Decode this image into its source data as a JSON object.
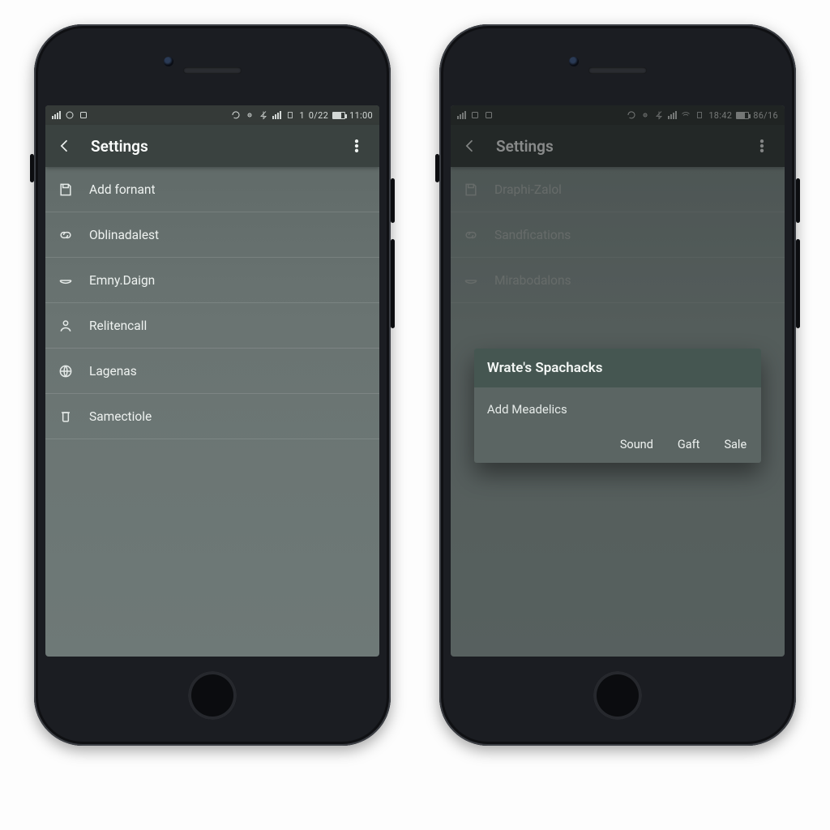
{
  "phone1": {
    "status": {
      "left_icons": [
        "signal-icon",
        "sync-icon",
        "card-icon"
      ],
      "right_icons": [
        "refresh-icon",
        "gps-icon",
        "bluetooth-icon",
        "signal-icon",
        "cell-icon"
      ],
      "right_text_1": "1",
      "right_text_2": "0/22",
      "time": "11:00"
    },
    "appbar": {
      "title": "Settings"
    },
    "items": [
      {
        "icon": "save-icon",
        "label": "Add fornant"
      },
      {
        "icon": "link-icon",
        "label": "Oblinadalest"
      },
      {
        "icon": "bowl-icon",
        "label": "Emny.Daign"
      },
      {
        "icon": "person-icon",
        "label": "Relitencall"
      },
      {
        "icon": "globe-icon",
        "label": "Lagenas"
      },
      {
        "icon": "trash-icon",
        "label": "Samectiole"
      }
    ]
  },
  "phone2": {
    "status": {
      "left_icons": [
        "signal-icon",
        "card-icon",
        "card-icon"
      ],
      "right_icons": [
        "refresh-icon",
        "gps-icon",
        "bluetooth-icon",
        "signal-icon",
        "wifi-icon",
        "cell-icon"
      ],
      "right_text_1": "18:42",
      "right_text_2": "86/16"
    },
    "appbar": {
      "title": "Settings"
    },
    "items": [
      {
        "icon": "save-icon",
        "label": "Draphi-Zalol"
      },
      {
        "icon": "link-icon",
        "label": "Sandfications"
      },
      {
        "icon": "bowl-icon",
        "label": "Mirabodalons"
      }
    ],
    "dialog": {
      "title": "Wrate's Spachacks",
      "body": "Add Meadelics",
      "actions": [
        "Sound",
        "Gaft",
        "Sale"
      ]
    }
  }
}
